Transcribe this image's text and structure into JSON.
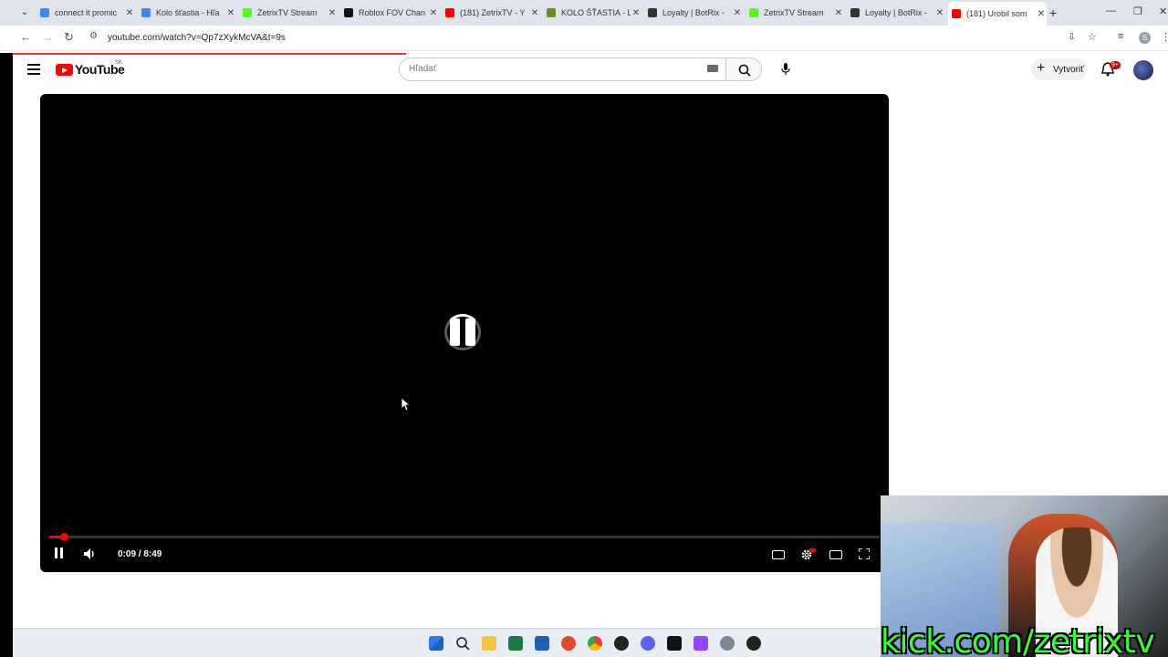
{
  "browser": {
    "tabs": [
      {
        "title": "connect it promic",
        "icon": "google-icon",
        "color": "#4285f4"
      },
      {
        "title": "Kolo šťastia - Hľa",
        "icon": "google-icon",
        "color": "#4285f4"
      },
      {
        "title": "ZetrixTV Stream",
        "icon": "kick-icon",
        "color": "#53fc18"
      },
      {
        "title": "Roblox FOV Chan",
        "icon": "github-icon",
        "color": "#111111"
      },
      {
        "title": "(181) ZetrixTV - Y",
        "icon": "youtube-icon",
        "color": "#ff0000"
      },
      {
        "title": "KOLO ŠŤASTIA - L",
        "icon": "wheel-icon",
        "color": "#6b8e23"
      },
      {
        "title": "Loyalty | BotRix -",
        "icon": "botrix-icon",
        "color": "#333333"
      },
      {
        "title": "ZetrixTV Stream",
        "icon": "kick-icon",
        "color": "#53fc18"
      },
      {
        "title": "Loyalty | BotRix -",
        "icon": "botrix-icon",
        "color": "#333333"
      },
      {
        "title": "(181) Urobil som",
        "icon": "youtube-icon",
        "color": "#ff0000"
      }
    ],
    "url": "youtube.com/watch?v=Qp7zXykMcVA&t=9s",
    "profile_initial": "S"
  },
  "youtube": {
    "logo_text": "YouTube",
    "country_code": "SK",
    "search_placeholder": "Hľadať",
    "create_label": "Vytvoriť",
    "notification_count": "9+"
  },
  "player": {
    "time_display": "0:09 / 8:49",
    "progress_fraction": 0.0177,
    "state": "buffering"
  },
  "webcam": {
    "overlay_text": "kick.com/zetrixtv"
  },
  "colors": {
    "youtube_red": "#ff0000",
    "kick_green": "#33ff33"
  }
}
